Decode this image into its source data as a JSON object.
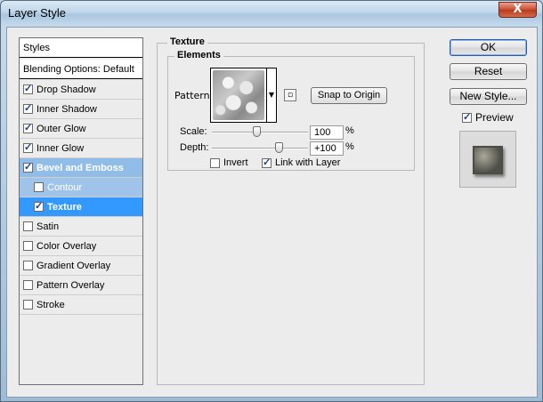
{
  "window": {
    "title": "Layer Style",
    "close_glyph": "X"
  },
  "styles_list": {
    "header": "Styles",
    "blending": "Blending Options: Default",
    "items": [
      {
        "label": "Drop Shadow",
        "checked": true
      },
      {
        "label": "Inner Shadow",
        "checked": true
      },
      {
        "label": "Outer Glow",
        "checked": true
      },
      {
        "label": "Inner Glow",
        "checked": true
      },
      {
        "label": "Bevel and Emboss",
        "checked": true
      },
      {
        "label": "Contour",
        "checked": false
      },
      {
        "label": "Texture",
        "checked": true
      },
      {
        "label": "Satin",
        "checked": false
      },
      {
        "label": "Color Overlay",
        "checked": false
      },
      {
        "label": "Gradient Overlay",
        "checked": false
      },
      {
        "label": "Pattern Overlay",
        "checked": false
      },
      {
        "label": "Stroke",
        "checked": false
      }
    ]
  },
  "texture": {
    "group_title": "Texture",
    "elements_title": "Elements",
    "pattern_label": "Pattern:",
    "snap_button": "Snap to Origin",
    "scale_label": "Scale:",
    "scale_value": "100",
    "scale_unit": "%",
    "depth_label": "Depth:",
    "depth_value": "+100",
    "depth_unit": "%",
    "invert_label": "Invert",
    "invert_checked": false,
    "link_label": "Link with Layer",
    "link_checked": true
  },
  "buttons": {
    "ok": "OK",
    "reset": "Reset",
    "new_style": "New Style...",
    "preview_label": "Preview",
    "preview_checked": true
  }
}
